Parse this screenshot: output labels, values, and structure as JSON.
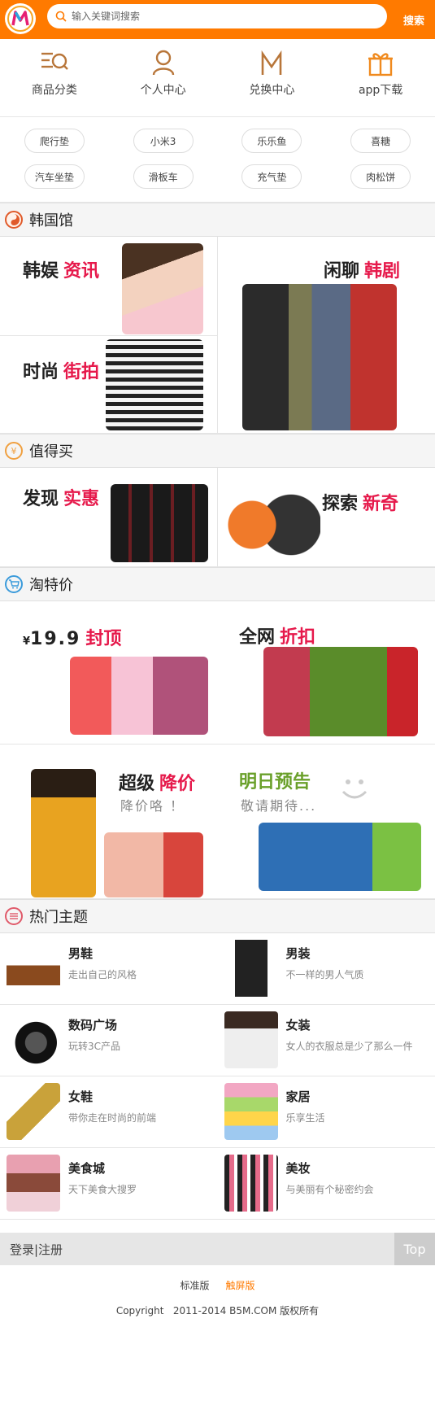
{
  "header": {
    "logo": "M",
    "search_placeholder": "输入关键词搜索",
    "search_button": "搜索"
  },
  "nav": [
    {
      "label": "商品分类",
      "icon": "category-list-icon"
    },
    {
      "label": "个人中心",
      "icon": "user-icon"
    },
    {
      "label": "兑换中心",
      "icon": "exchange-m-icon"
    },
    {
      "label": "app下载",
      "icon": "gift-icon"
    }
  ],
  "tags": [
    "爬行垫",
    "小米3",
    "乐乐鱼",
    "喜糖",
    "汽车坐垫",
    "滑板车",
    "充气垫",
    "肉松饼"
  ],
  "sections": {
    "korea": {
      "title": "韩国馆",
      "icon": "korea-flag-icon"
    },
    "worth": {
      "title": "值得买",
      "icon": "yen-icon"
    },
    "tao": {
      "title": "淘特价",
      "icon": "cart-icon"
    },
    "hot": {
      "title": "热门主题",
      "icon": "list-icon"
    }
  },
  "korea": {
    "ent": {
      "a": "韩娱",
      "b": "资讯"
    },
    "chat": {
      "a": "闲聊",
      "b": "韩剧"
    },
    "street": {
      "a": "时尚",
      "b": "街拍"
    }
  },
  "worth": {
    "discover": {
      "a": "发现",
      "b": "实惠"
    },
    "explore": {
      "a": "探索",
      "b": "新奇"
    }
  },
  "tao": {
    "price": {
      "currency": "¥",
      "amount": "19.9",
      "b": "封顶"
    },
    "discount": {
      "a": "全网",
      "b": "折扣"
    },
    "super": {
      "a": "超级",
      "b": "降价",
      "sub": "降价咯 ！"
    },
    "tomorrow": {
      "a": "明日预告",
      "sub": "敬请期待..."
    }
  },
  "topics": [
    {
      "name": "男鞋",
      "desc": "走出自己的风格",
      "icon": "mens-shoe-icon"
    },
    {
      "name": "男装",
      "desc": "不一样的男人气质",
      "icon": "mens-clothing-icon"
    },
    {
      "name": "数码广场",
      "desc": "玩转3C产品",
      "icon": "camera-icon"
    },
    {
      "name": "女装",
      "desc": "女人的衣服总是少了那么一件",
      "icon": "womens-clothing-icon"
    },
    {
      "name": "女鞋",
      "desc": "带你走在时尚的前端",
      "icon": "high-heel-icon"
    },
    {
      "name": "家居",
      "desc": "乐享生活",
      "icon": "pillows-icon"
    },
    {
      "name": "美食城",
      "desc": "天下美食大搜罗",
      "icon": "macaron-icon"
    },
    {
      "name": "美妆",
      "desc": "与美丽有个秘密约会",
      "icon": "lipstick-icon"
    }
  ],
  "login": {
    "text": "登录|注册",
    "top": "Top"
  },
  "footer": {
    "standard": "标准版",
    "touch": "触屏版",
    "copyright": "Copyright   2011-2014 B5M.COM 版权所有"
  },
  "colors": {
    "accent": "#ff7a00",
    "highlight": "#e6194b",
    "green": "#6aa02a"
  }
}
